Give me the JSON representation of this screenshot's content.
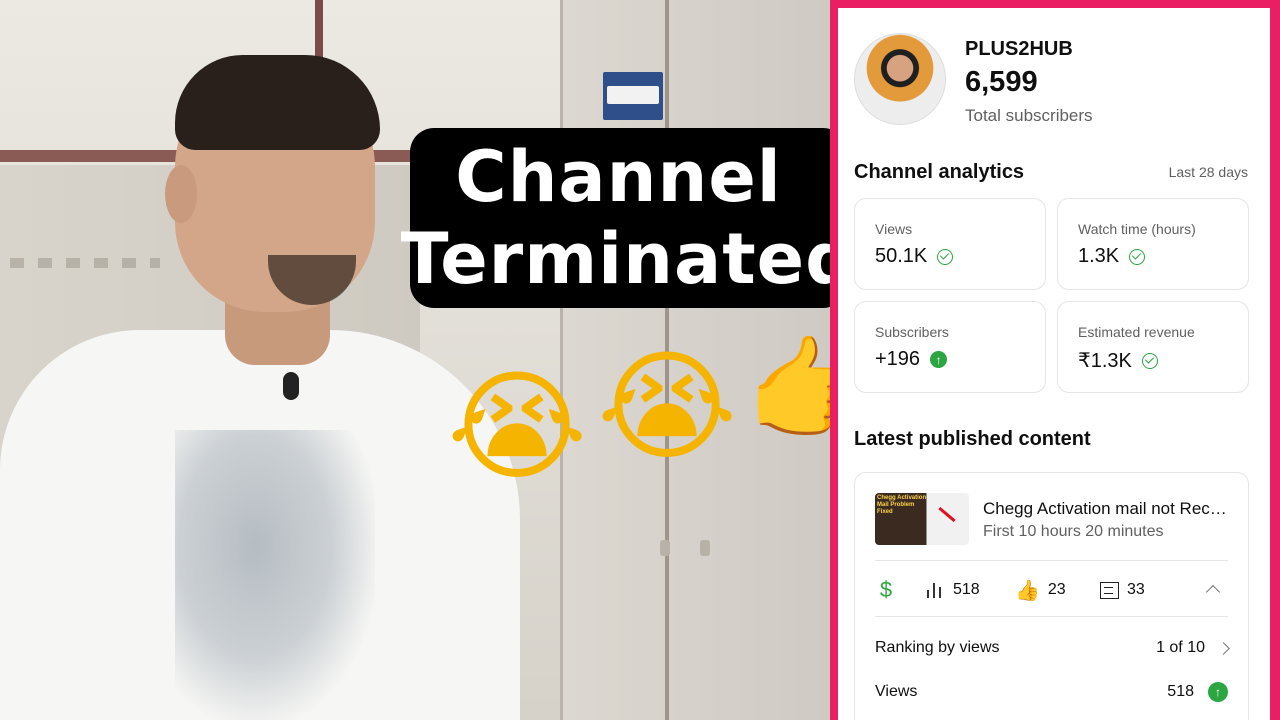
{
  "overlay": {
    "title_line1": "Channel",
    "title_line2": "Terminated",
    "emoji_cry": "😭",
    "emoji_point": "👉"
  },
  "channel": {
    "name": "PLUS2HUB",
    "subscriber_count": "6,599",
    "subscriber_label": "Total subscribers"
  },
  "analytics": {
    "title": "Channel analytics",
    "period": "Last 28 days",
    "cards": [
      {
        "label": "Views",
        "value": "50.1K",
        "indicator": "check"
      },
      {
        "label": "Watch time (hours)",
        "value": "1.3K",
        "indicator": "check"
      },
      {
        "label": "Subscribers",
        "value": "+196",
        "indicator": "up"
      },
      {
        "label": "Estimated revenue",
        "value": "₹1.3K",
        "indicator": "check"
      }
    ]
  },
  "latest": {
    "title": "Latest published content",
    "video": {
      "title": "Chegg Activation mail not Rece...",
      "subtitle": "First 10 hours 20 minutes",
      "thumb_text": "Chegg Activation Mail Problem Fixed"
    },
    "stats": {
      "currency_icon": "$",
      "views": "518",
      "likes": "23",
      "comments": "33"
    },
    "ranking_label": "Ranking by views",
    "ranking_value": "1 of 10",
    "views_label": "Views",
    "views_value": "518"
  },
  "colors": {
    "frame": "#e91e63",
    "accent_green": "#2ba640",
    "title_box": "#000000"
  },
  "icons": [
    "checkmark-circle-icon",
    "arrow-up-circle-icon",
    "dollar-icon",
    "bar-chart-icon",
    "thumbs-up-icon",
    "comment-icon",
    "chevron-up-icon",
    "chevron-right-icon"
  ]
}
